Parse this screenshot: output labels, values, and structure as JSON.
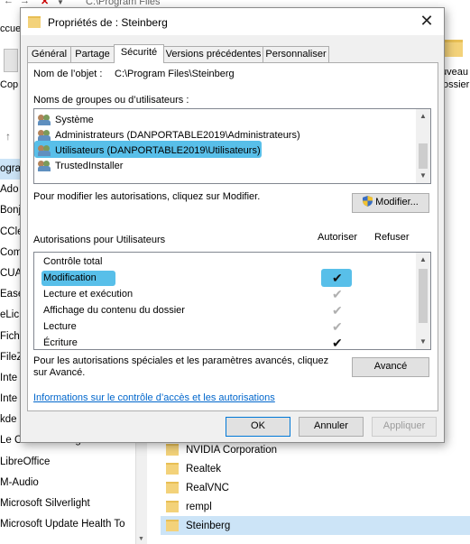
{
  "background": {
    "address": "C:\\Program Files",
    "left_items": [
      "ogra",
      "Ado",
      "Bonj",
      "CCle",
      "Com",
      "CUA",
      "Ease",
      "eLic",
      "Fich",
      "FileZ",
      "Inte",
      "Inte",
      "kde",
      "Le Cloud d'Orange",
      "LibreOffice",
      "M-Audio",
      "Microsoft Silverlight",
      "Microsoft Update Health To"
    ],
    "ribbon_left": [
      "ccue",
      "Cop"
    ],
    "ribbon_right": [
      "uveau",
      "ossier"
    ],
    "folders": [
      "NVIDIA Corporation",
      "Realtek",
      "RealVNC",
      "rempl",
      "Steinberg"
    ],
    "selected_folder": "Steinberg"
  },
  "dialog": {
    "title": "Propriétés de : Steinberg",
    "tabs": [
      "Général",
      "Partage",
      "Sécurité",
      "Versions précédentes",
      "Personnaliser"
    ],
    "active_tab": "Sécurité",
    "object_name_label": "Nom de l’objet :",
    "object_name_value": "C:\\Program Files\\Steinberg",
    "groups_label": "Noms de groupes ou d’utilisateurs :",
    "groups": [
      "Système",
      "Administrateurs (DANPORTABLE2019\\Administrateurs)",
      "Utilisateurs (DANPORTABLE2019\\Utilisateurs)",
      "TrustedInstaller"
    ],
    "selected_group": "Utilisateurs (DANPORTABLE2019\\Utilisateurs)",
    "modify_hint": "Pour modifier les autorisations, cliquez sur Modifier.",
    "modify_button": "Modifier...",
    "permissions_label": "Autorisations pour Utilisateurs",
    "col_allow": "Autoriser",
    "col_deny": "Refuser",
    "permissions": [
      {
        "name": "Contrôle total",
        "allow": "none"
      },
      {
        "name": "Modification",
        "allow": "black"
      },
      {
        "name": "Lecture et exécution",
        "allow": "grey"
      },
      {
        "name": "Affichage du contenu du dossier",
        "allow": "grey"
      },
      {
        "name": "Lecture",
        "allow": "grey"
      },
      {
        "name": "Écriture",
        "allow": "black"
      }
    ],
    "special_hint": "Pour les autorisations spéciales et les paramètres avancés, cliquez sur Avancé.",
    "advanced_button": "Avancé",
    "info_link": "Informations sur le contrôle d’accès et les autorisations",
    "ok_button": "OK",
    "cancel_button": "Annuler",
    "apply_button": "Appliquer"
  },
  "colors": {
    "highlight": "#3bb4e5",
    "link": "#0066cc",
    "dialog_bg": "#f0f0f0"
  }
}
